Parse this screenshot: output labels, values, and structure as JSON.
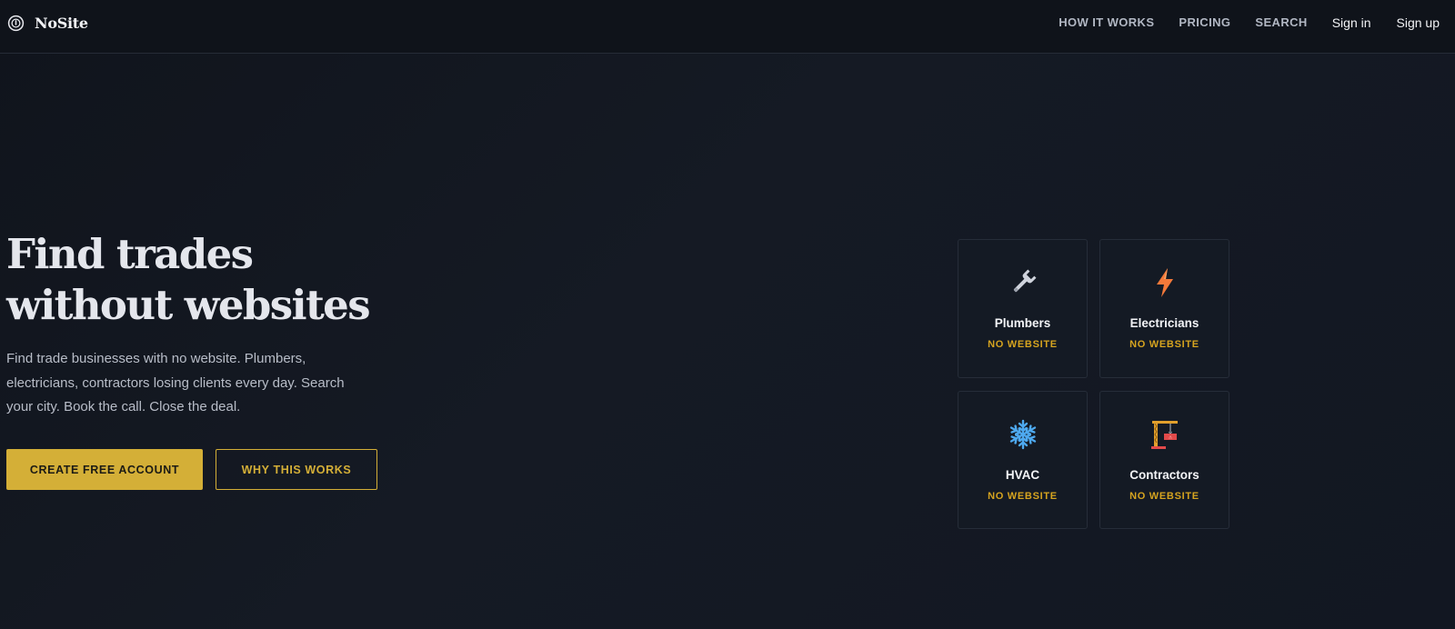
{
  "brand": {
    "name": "NoSite",
    "icon": "circle-badge-icon"
  },
  "nav": {
    "how_it_works": "HOW IT WORKS",
    "pricing": "PRICING",
    "search": "SEARCH",
    "sign_in": "Sign in",
    "sign_up": "Sign up"
  },
  "hero": {
    "title_line1": "Find trades",
    "title_line2": "without websites",
    "subtitle": "Find trade businesses with no website. Plumbers, electricians, contractors losing clients every day. Search your city. Book the call. Close the deal.",
    "primary_cta": "CREATE FREE ACCOUNT",
    "secondary_cta": "WHY THIS WORKS"
  },
  "cards": [
    {
      "title": "Plumbers",
      "tag": "NO WEBSITE",
      "icon": "wrench-icon"
    },
    {
      "title": "Electricians",
      "tag": "NO WEBSITE",
      "icon": "lightning-icon"
    },
    {
      "title": "HVAC",
      "tag": "NO WEBSITE",
      "icon": "snowflake-icon"
    },
    {
      "title": "Contractors",
      "tag": "NO WEBSITE",
      "icon": "crane-icon"
    }
  ],
  "colors": {
    "background": "#131822",
    "header": "#0f131a",
    "accent": "#d4af37",
    "tag": "#d6a41f",
    "card_border": "#262d39"
  }
}
